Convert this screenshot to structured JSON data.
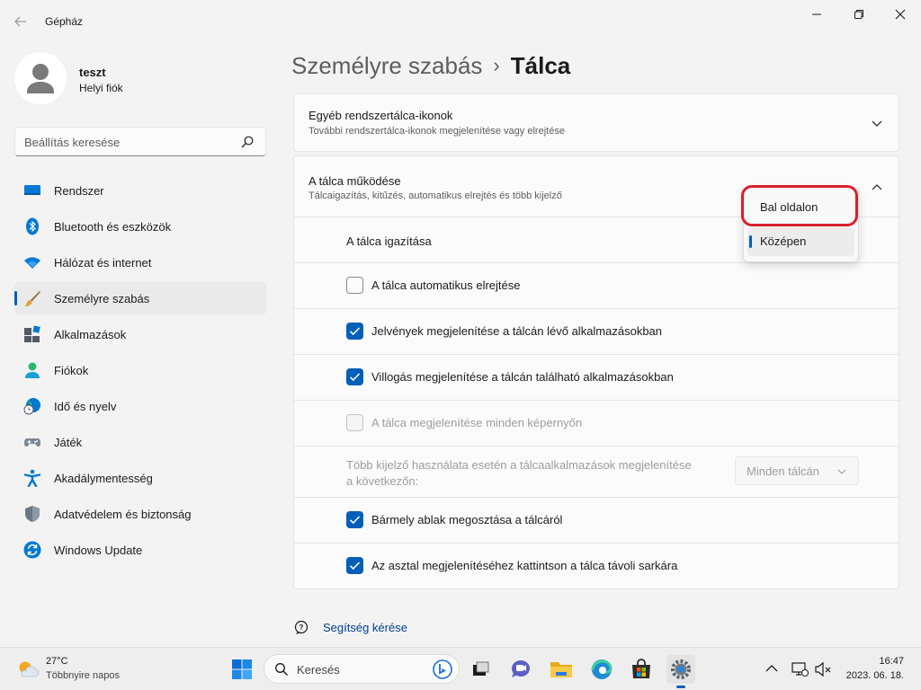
{
  "window": {
    "title": "Gépház",
    "back_icon": "arrow-left-icon",
    "minimize_icon": "minimize-icon",
    "maximize_icon": "restore-icon",
    "close_icon": "close-icon"
  },
  "profile": {
    "name": "teszt",
    "account_type": "Helyi fiók"
  },
  "search": {
    "placeholder": "Beállítás keresése",
    "icon": "search-icon"
  },
  "sidebar": {
    "items": [
      {
        "label": "Rendszer",
        "icon": "system-display-icon",
        "active": false
      },
      {
        "label": "Bluetooth és eszközök",
        "icon": "bluetooth-icon",
        "active": false
      },
      {
        "label": "Hálózat és internet",
        "icon": "wifi-icon",
        "active": false
      },
      {
        "label": "Személyre szabás",
        "icon": "paintbrush-icon",
        "active": true
      },
      {
        "label": "Alkalmazások",
        "icon": "apps-icon",
        "active": false
      },
      {
        "label": "Fiókok",
        "icon": "person-icon",
        "active": false
      },
      {
        "label": "Idő és nyelv",
        "icon": "globe-clock-icon",
        "active": false
      },
      {
        "label": "Játék",
        "icon": "gamepad-icon",
        "active": false
      },
      {
        "label": "Akadálymentesség",
        "icon": "accessibility-icon",
        "active": false
      },
      {
        "label": "Adatvédelem és biztonság",
        "icon": "shield-icon",
        "active": false
      },
      {
        "label": "Windows Update",
        "icon": "windows-update-icon",
        "active": false
      }
    ]
  },
  "breadcrumb": {
    "parent": "Személyre szabás",
    "separator": "›",
    "current": "Tálca"
  },
  "other_icons_card": {
    "title": "Egyéb rendszertálca-ikonok",
    "subtitle": "További rendszertálca-ikonok megjelenítése vagy elrejtése",
    "expanded": false
  },
  "behaviors_card": {
    "title": "A tálca működése",
    "subtitle": "Tálcaigazítás, kitűzés, automatikus elrejtés és több kijelző",
    "expanded": true
  },
  "alignment": {
    "label": "A tálca igazítása",
    "dropdown_options": [
      "Bal oldalon",
      "Középen"
    ],
    "selected": "Középen",
    "highlighted_option": "Bal oldalon"
  },
  "settings": {
    "auto_hide": {
      "label": "A tálca automatikus elrejtése",
      "checked": false,
      "enabled": true
    },
    "badges": {
      "label": "Jelvények megjelenítése a tálcán lévő alkalmazásokban",
      "checked": true,
      "enabled": true
    },
    "flashing": {
      "label": "Villogás megjelenítése a tálcán található alkalmazásokban",
      "checked": true,
      "enabled": true
    },
    "all_displays": {
      "label": "A tálca megjelenítése minden képernyőn",
      "checked": false,
      "enabled": false
    },
    "multi_display": {
      "label_line1": "Több kijelző használata esetén a tálcaalkalmazások megjelenítése",
      "label_line2": "a következőn:",
      "value": "Minden tálcán",
      "enabled": false
    },
    "share_window": {
      "label": "Bármely ablak megosztása a tálcáról",
      "checked": true,
      "enabled": true
    },
    "far_corner": {
      "label": "Az asztal megjelenítéséhez kattintson a tálca távoli sarkára",
      "checked": true,
      "enabled": true
    }
  },
  "help": {
    "label": "Segítség kérése",
    "icon": "help-chat-icon"
  },
  "taskbar": {
    "weather_temp": "27°C",
    "weather_desc": "Többnyire napos",
    "search_label": "Keresés",
    "apps": [
      "windows-start-icon",
      "bing-icon",
      "task-view-icon",
      "teams-chat-icon",
      "file-explorer-icon",
      "edge-icon",
      "store-icon",
      "settings-gear-icon"
    ],
    "tray_icons": [
      "chevron-up-icon",
      "network-icon",
      "volume-muted-icon"
    ],
    "time": "16:47",
    "date": "2023. 06. 18."
  },
  "colors": {
    "accent": "#005fb8",
    "highlight_annotation": "#d8202a",
    "background": "#f3f3f3",
    "card": "#fbfbfb"
  }
}
